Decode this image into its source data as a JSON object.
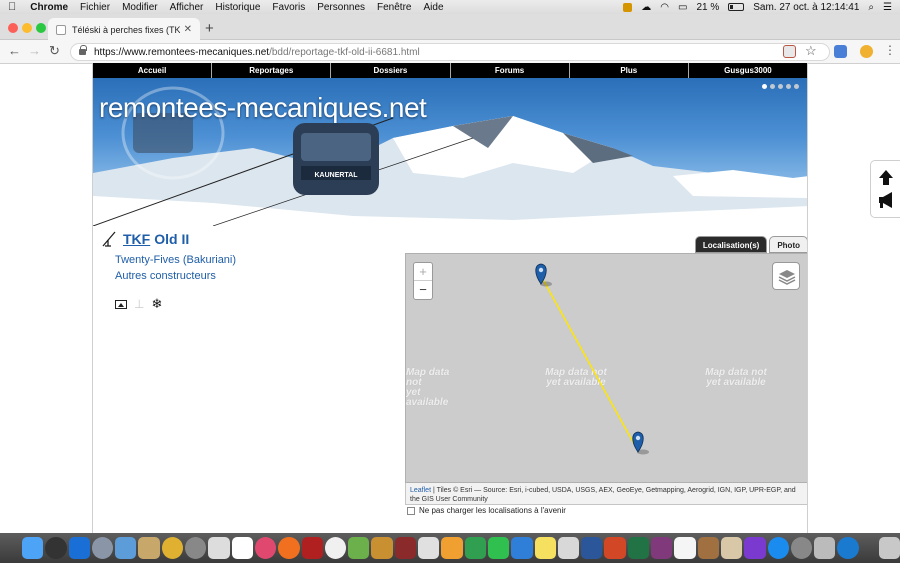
{
  "menubar": {
    "app_name": "Chrome",
    "items": [
      "Fichier",
      "Modifier",
      "Afficher",
      "Historique",
      "Favoris",
      "Personnes",
      "Fenêtre",
      "Aide"
    ],
    "battery": "21 %",
    "datetime": "Sam. 27 oct. à 12:14:41"
  },
  "browser": {
    "tab_title": "Téléski à perches fixes (TKF) O",
    "url_host": "https://www.remontees-mecaniques.net",
    "url_path": "/bdd/reportage-tkf-old-ii-6681.html"
  },
  "site": {
    "nav": [
      "Accueil",
      "Reportages",
      "Dossiers",
      "Forums",
      "Plus",
      "Gusgus3000"
    ],
    "banner_title": "remontees-mecaniques.net",
    "gondola_brand": "KAUNERTAL"
  },
  "lift": {
    "code": "TKF",
    "name": "Old II",
    "location": "Twenty-Fives (Bakuriani)",
    "manufacturer": "Autres constructeurs"
  },
  "map": {
    "tabs": {
      "active": "Localisation(s)",
      "inactive": "Photo"
    },
    "zoom_in": "+",
    "zoom_out": "−",
    "tile_text_line1": "Map data not",
    "tile_text_line2": "yet available",
    "attribution_link": "Leaflet",
    "attribution_text": " | Tiles © Esri — Source: Esri, i-cubed, USDA, USGS, AEX, GeoEye, Getmapping, Aerogrid, IGN, IGP, UPR-EGP, and the GIS User Community",
    "no_load_label": "Ne pas charger les localisations à l'avenir",
    "line_color": "#ffe600",
    "marker_color": "#1f5ea8"
  },
  "colors": {
    "accent": "#1f5ea8",
    "nav_bg": "#000000",
    "map_bg": "#cccccc"
  }
}
